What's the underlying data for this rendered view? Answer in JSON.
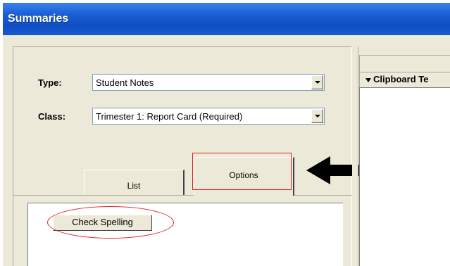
{
  "window": {
    "title": "Summaries"
  },
  "form": {
    "type_label": "Type:",
    "type_value": "Student Notes",
    "class_label": "Class:",
    "class_value": "Trimester 1: Report Card (Required)"
  },
  "tabs": [
    {
      "label": "List",
      "selected": false
    },
    {
      "label": "Options",
      "selected": true
    }
  ],
  "options_panel": {
    "check_spelling_label": "Check Spelling"
  },
  "clipboard": {
    "title": "Clipboard Te"
  },
  "annotations": {
    "highlight_color": "#e02020",
    "arrow_color": "#000000"
  }
}
